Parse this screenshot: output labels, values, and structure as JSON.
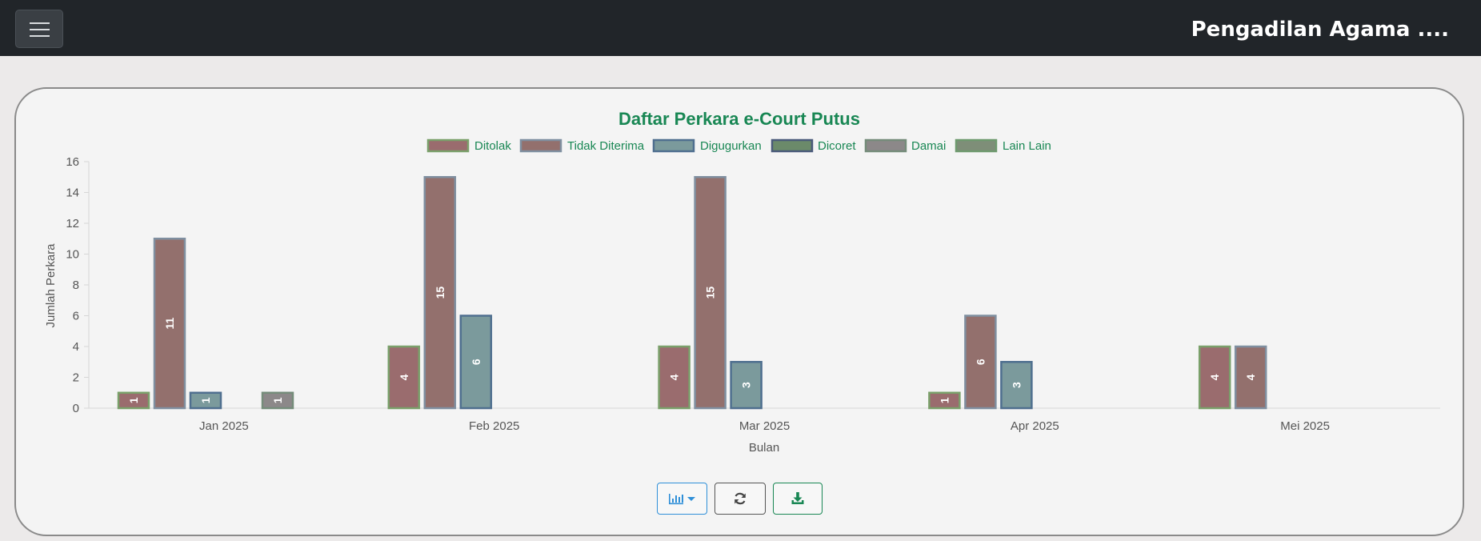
{
  "header": {
    "title": "Pengadilan Agama ...."
  },
  "colors": {
    "title": "#198754",
    "legend_text": "#198754",
    "axis_text": "#555555"
  },
  "chart_data": {
    "type": "bar",
    "title": "Daftar Perkara e-Court Putus",
    "xlabel": "Bulan",
    "ylabel": "Jumlah Perkara",
    "ylim": [
      0,
      16
    ],
    "yticks": [
      0,
      2,
      4,
      6,
      8,
      10,
      12,
      14,
      16
    ],
    "categories": [
      "Jan 2025",
      "Feb 2025",
      "Mar 2025",
      "Apr 2025",
      "Mei 2025"
    ],
    "legend_position": "top",
    "series": [
      {
        "name": "Ditolak",
        "fill": "#9a6c6e",
        "stroke": "#7aa06a",
        "values": [
          1,
          4,
          4,
          1,
          4
        ]
      },
      {
        "name": "Tidak Diterima",
        "fill": "#93706d",
        "stroke": "#7f8fa0",
        "values": [
          11,
          15,
          15,
          6,
          4
        ]
      },
      {
        "name": "Digugurkan",
        "fill": "#7b9a9c",
        "stroke": "#4f6f8f",
        "values": [
          1,
          6,
          3,
          3,
          0
        ]
      },
      {
        "name": "Dicoret",
        "fill": "#6b8a6a",
        "stroke": "#4a5a7a",
        "values": [
          0,
          0,
          0,
          0,
          0
        ]
      },
      {
        "name": "Damai",
        "fill": "#8c8889",
        "stroke": "#758c7a",
        "values": [
          1,
          0,
          0,
          0,
          0
        ]
      },
      {
        "name": "Lain Lain",
        "fill": "#7e8e78",
        "stroke": "#6e9a6e",
        "values": [
          0,
          0,
          0,
          0,
          0
        ]
      }
    ]
  },
  "toolbar": {
    "chart_type_icon": "bar-chart-icon",
    "refresh_icon": "refresh-icon",
    "download_icon": "download-icon"
  }
}
